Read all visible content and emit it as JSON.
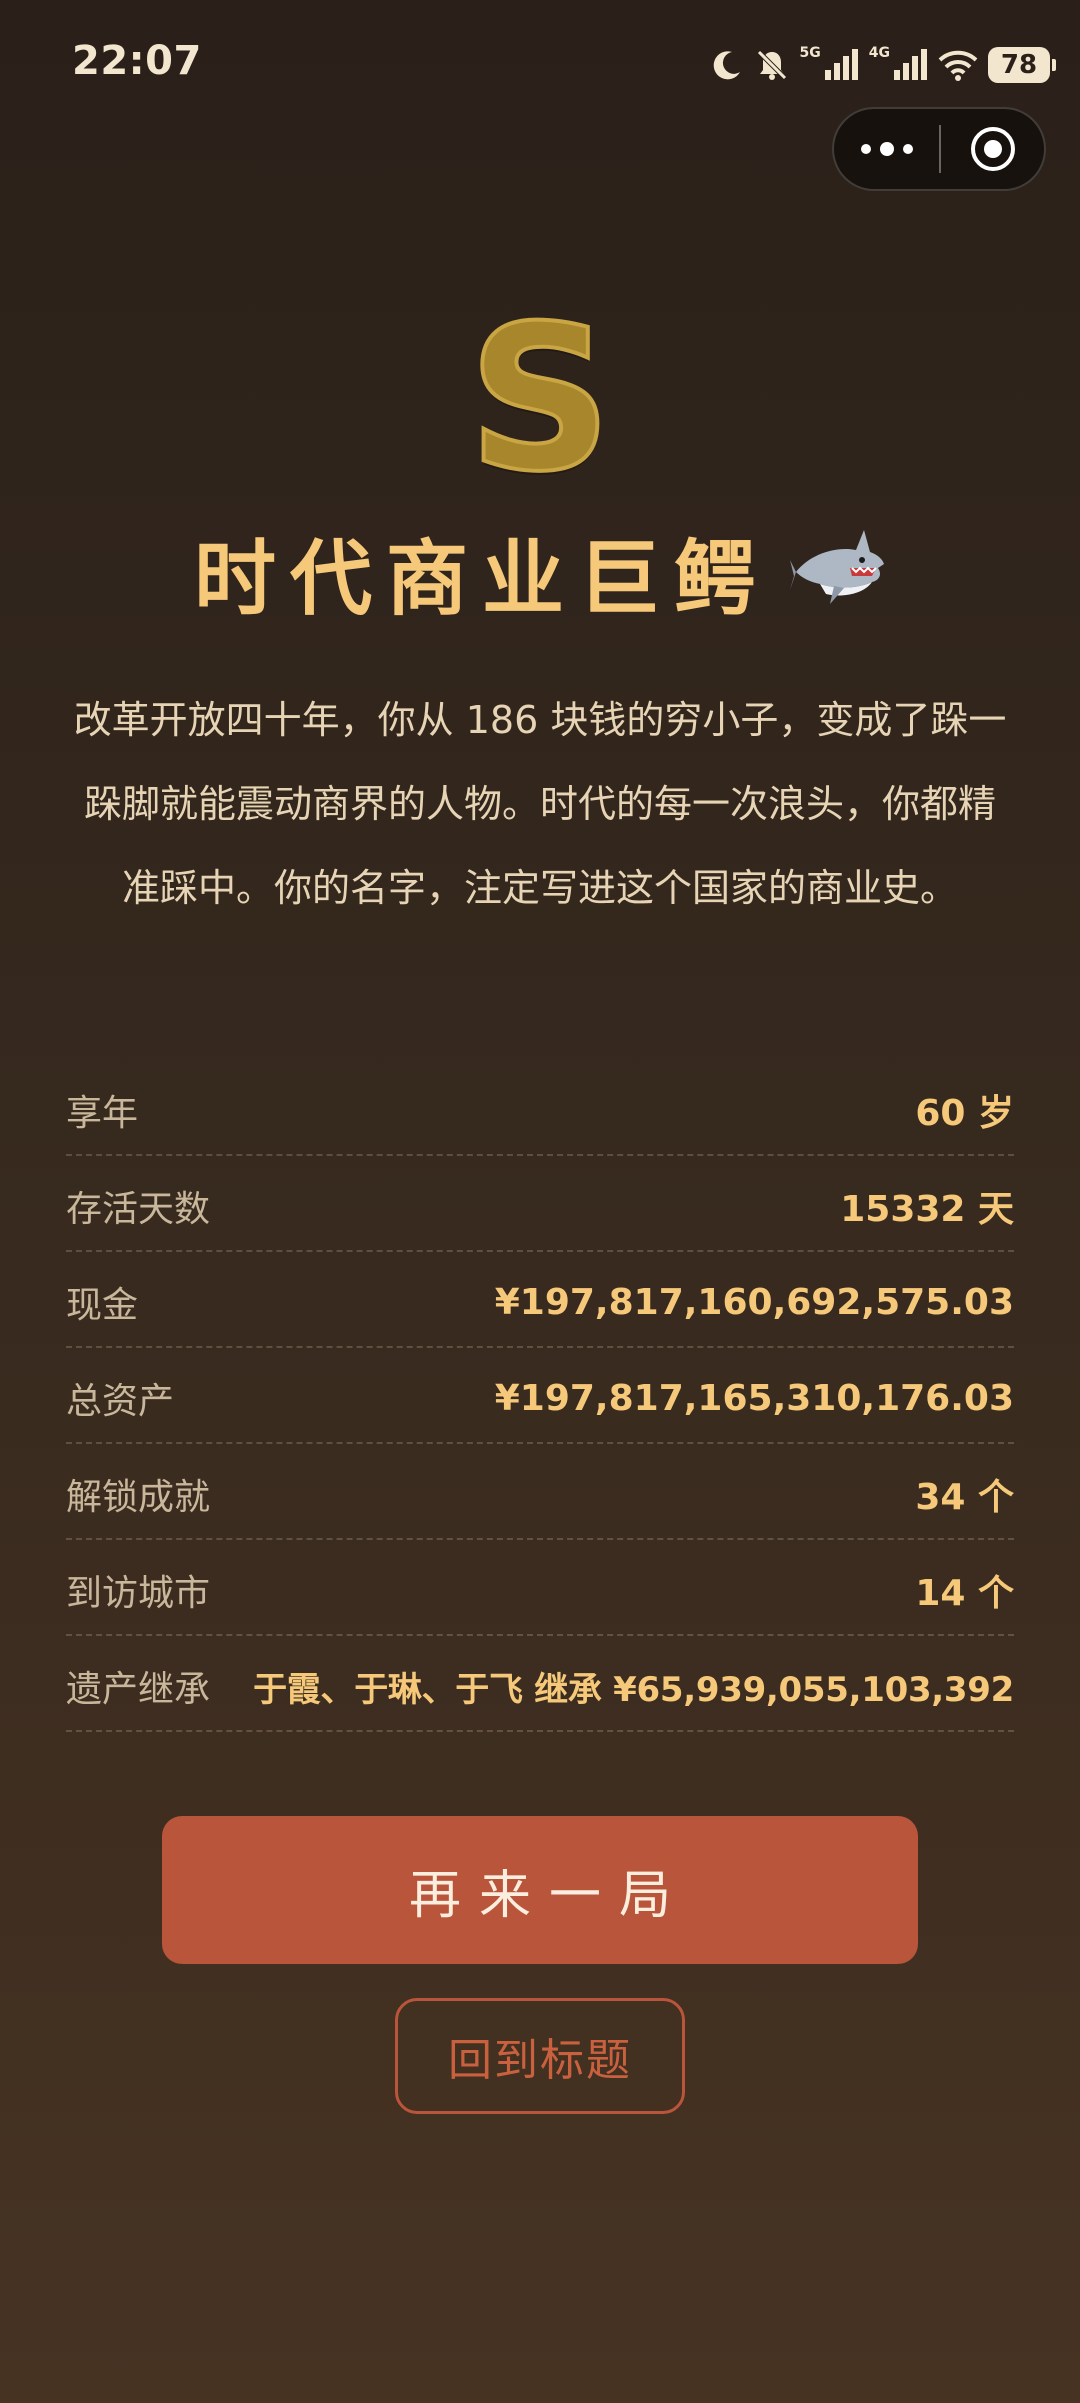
{
  "status_bar": {
    "time": "22:07",
    "net1": "5G",
    "net2": "4G",
    "battery": "78"
  },
  "capsule": {
    "more_icon": "more-dots-icon",
    "close_icon": "target-close-icon"
  },
  "result": {
    "rank": "S",
    "title": "时代商业巨鳄",
    "title_emoji": "shark-icon",
    "description": "改革开放四十年，你从 186 块钱的穷小子，变成了跺一跺脚就能震动商界的人物。时代的每一次浪头，你都精准踩中。你的名字，注定写进这个国家的商业史。"
  },
  "stats": [
    {
      "label": "享年",
      "value": "60 岁"
    },
    {
      "label": "存活天数",
      "value": "15332 天"
    },
    {
      "label": "现金",
      "value": "¥197,817,160,692,575.03"
    },
    {
      "label": "总资产",
      "value": "¥197,817,165,310,176.03"
    },
    {
      "label": "解锁成就",
      "value": "34 个"
    },
    {
      "label": "到访城市",
      "value": "14 个"
    },
    {
      "label": "遗产继承",
      "value": "于霞、于琳、于飞 继承 ¥65,939,055,103,392"
    }
  ],
  "buttons": {
    "play_again": "再来一局",
    "back_to_title": "回到标题"
  },
  "colors": {
    "accent_gold": "#f5c87a",
    "rank_gold": "#a8862b",
    "button_red": "#b9553a",
    "background": "#2a2019"
  }
}
